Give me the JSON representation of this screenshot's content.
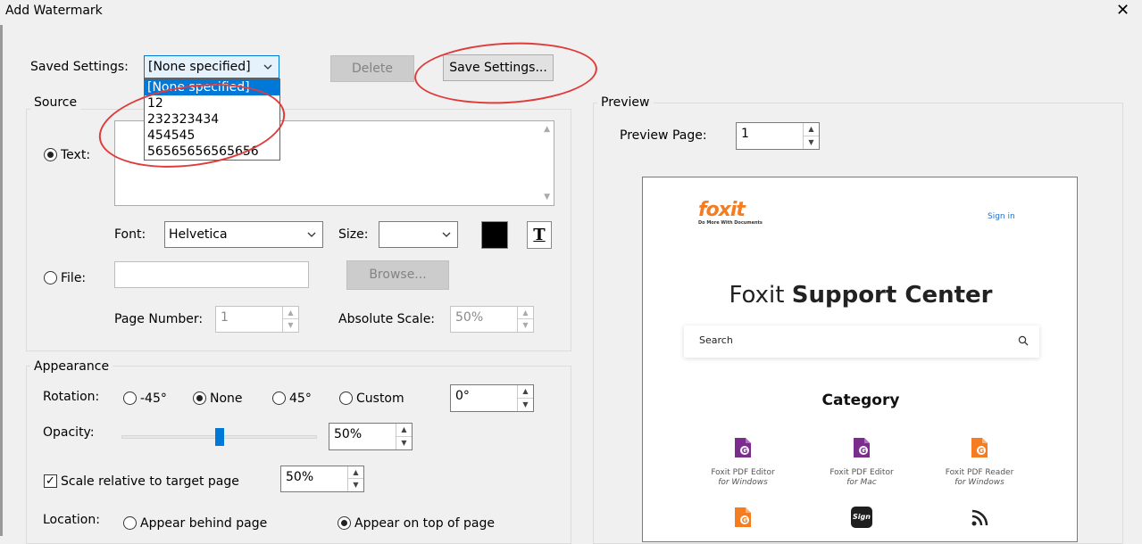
{
  "window": {
    "title": "Add Watermark",
    "close_glyph": "✕"
  },
  "saved_settings": {
    "label": "Saved Settings:",
    "selected": "[None specified]",
    "options": [
      "[None specified]",
      "12",
      "232323434",
      "454545",
      "56565656565656"
    ],
    "delete_label": "Delete",
    "save_label": "Save Settings..."
  },
  "source": {
    "group_label": "Source",
    "text_label": "Text:",
    "text_value": "",
    "font_label": "Font:",
    "font_value": "Helvetica",
    "size_label": "Size:",
    "size_value": "",
    "color": "#000000",
    "text_format_glyph": "T",
    "file_label": "File:",
    "file_value": "",
    "browse_label": "Browse...",
    "page_number_label": "Page Number:",
    "page_number_value": "1",
    "absolute_scale_label": "Absolute Scale:",
    "absolute_scale_value": "50%"
  },
  "appearance": {
    "group_label": "Appearance",
    "rotation_label": "Rotation:",
    "rotation_options": [
      "-45°",
      "None",
      "45°",
      "Custom"
    ],
    "rotation_selected": "None",
    "rotation_custom_value": "0°",
    "opacity_label": "Opacity:",
    "opacity_value": "50%",
    "opacity_fraction": 0.5,
    "scale_relative_label": "Scale relative to target page",
    "scale_relative_checked": true,
    "scale_relative_value": "50%",
    "location_label": "Location:",
    "location_options": [
      "Appear behind page",
      "Appear on top of page"
    ],
    "location_selected": "Appear on top of page"
  },
  "preview": {
    "group_label": "Preview",
    "page_label": "Preview Page:",
    "page_value": "1",
    "page": {
      "logo_text": "foxit",
      "logo_tagline": "Do More With Documents",
      "sign_in": "Sign in",
      "headline_light": "Foxit",
      "headline_bold": "Support Center",
      "search_placeholder": "Search",
      "category_heading": "Category",
      "categories": [
        {
          "name": "Foxit PDF Editor",
          "platform": "for Windows",
          "icon": "pdf-editor-icon"
        },
        {
          "name": "Foxit PDF Editor",
          "platform": "for Mac",
          "icon": "pdf-editor-icon"
        },
        {
          "name": "Foxit PDF Reader",
          "platform": "for Windows",
          "icon": "pdf-reader-icon"
        }
      ],
      "sign_badge": "Sign"
    }
  },
  "colors": {
    "selection": "#0078d7",
    "annotation": "#e03b3b",
    "foxit_orange": "#f57c20",
    "editor_purple": "#7b2d8e"
  }
}
